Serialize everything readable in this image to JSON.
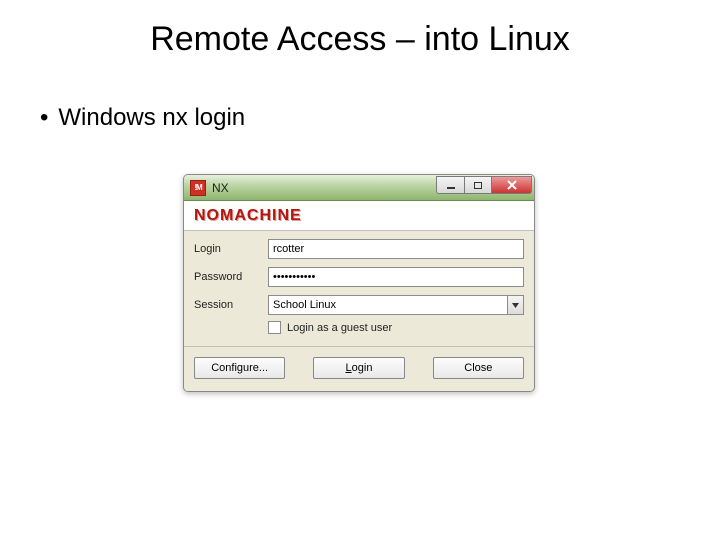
{
  "slide": {
    "title": "Remote Access – into Linux",
    "bullet": "Windows nx login"
  },
  "nx": {
    "window_title": "NX",
    "app_icon_text": "!M",
    "brand": "NOMACHINE",
    "labels": {
      "login": "Login",
      "password": "Password",
      "session": "Session"
    },
    "values": {
      "login": "rcotter",
      "password": "•••••••••••",
      "session": "School Linux"
    },
    "guest_checkbox": {
      "checked": false,
      "label": "Login as a guest user"
    },
    "buttons": {
      "configure": "Configure...",
      "login": "Login",
      "close": "Close"
    }
  }
}
